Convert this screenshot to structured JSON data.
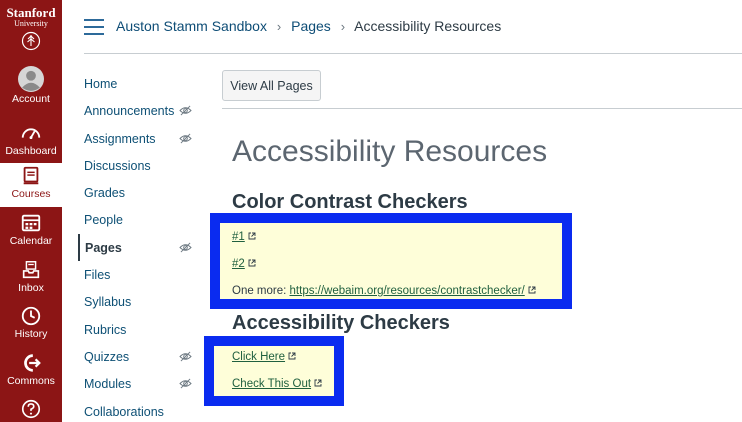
{
  "global_nav": {
    "brand_line1": "Stanford",
    "brand_line2": "University",
    "items": [
      {
        "label": "Account",
        "icon": "account-icon"
      },
      {
        "label": "Dashboard",
        "icon": "dashboard-icon"
      },
      {
        "label": "Courses",
        "icon": "courses-icon",
        "active": true
      },
      {
        "label": "Calendar",
        "icon": "calendar-icon"
      },
      {
        "label": "Inbox",
        "icon": "inbox-icon"
      },
      {
        "label": "History",
        "icon": "history-icon"
      },
      {
        "label": "Commons",
        "icon": "commons-icon"
      },
      {
        "label": "",
        "icon": "help-icon"
      }
    ],
    "colors": {
      "brand": "#8c1515",
      "text": "#ffffff"
    }
  },
  "breadcrumb": {
    "course": "Auston Stamm Sandbox",
    "section": "Pages",
    "current": "Accessibility Resources",
    "separator": "›"
  },
  "course_nav": {
    "items": [
      {
        "label": "Home",
        "hidden_icon": false
      },
      {
        "label": "Announcements",
        "hidden_icon": true
      },
      {
        "label": "Assignments",
        "hidden_icon": true
      },
      {
        "label": "Discussions",
        "hidden_icon": false
      },
      {
        "label": "Grades",
        "hidden_icon": false
      },
      {
        "label": "People",
        "hidden_icon": false
      },
      {
        "label": "Pages",
        "hidden_icon": true,
        "active": true
      },
      {
        "label": "Files",
        "hidden_icon": false
      },
      {
        "label": "Syllabus",
        "hidden_icon": false
      },
      {
        "label": "Rubrics",
        "hidden_icon": false
      },
      {
        "label": "Quizzes",
        "hidden_icon": true
      },
      {
        "label": "Modules",
        "hidden_icon": true
      },
      {
        "label": "Collaborations",
        "hidden_icon": false
      }
    ]
  },
  "content": {
    "view_all_label": "View All Pages",
    "page_title": "Accessibility Resources",
    "section1": {
      "heading": "Color Contrast Checkers",
      "link1": "#1",
      "link2": "#2",
      "more_prefix": "One more: ",
      "more_link": "https://webaim.org/resources/contrastchecker/"
    },
    "section2": {
      "heading": "Accessibility Checkers",
      "link1": "Click Here",
      "link2": "Check This Out"
    },
    "colors": {
      "highlight_border": "#0a2bf0",
      "highlight_bg": "#fefed9",
      "link": "#20603f"
    }
  }
}
